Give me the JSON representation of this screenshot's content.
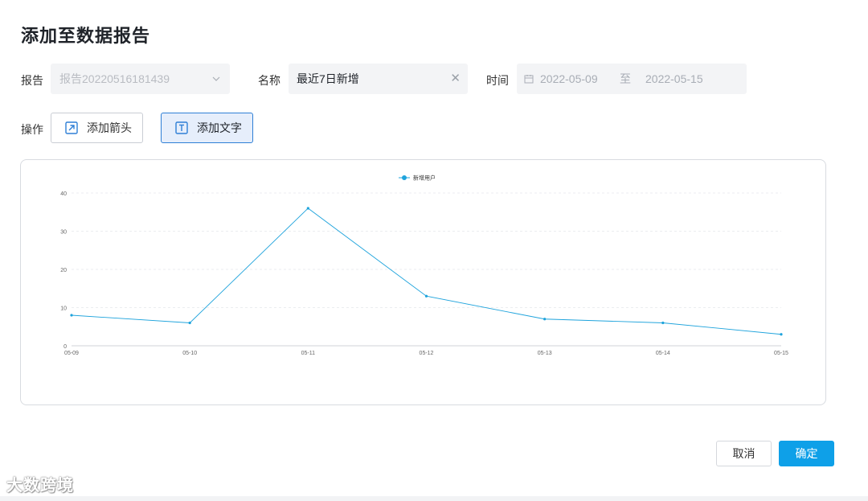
{
  "dialog": {
    "title": "添加至数据报告"
  },
  "form": {
    "report_label": "报告",
    "report_value": "报告20220516181439",
    "name_label": "名称",
    "name_value": "最近7日新增",
    "time_label": "时间",
    "date_start": "2022-05-09",
    "date_separator": "至",
    "date_end": "2022-05-15",
    "operation_label": "操作"
  },
  "operations": {
    "add_arrow": "添加箭头",
    "add_text": "添加文字"
  },
  "footer": {
    "cancel": "取消",
    "confirm": "确定"
  },
  "watermark": "大数跨境",
  "colors": {
    "accent": "#0ea0e8",
    "series": "#1ea3dc",
    "selected_bg": "#e6eefb",
    "selected_border": "#2e7fd6"
  },
  "icons": {
    "clear": "close-icon",
    "calendar": "calendar-icon",
    "dropdown": "chevron-down-icon",
    "arrow": "arrow-up-right-icon",
    "text": "text-icon"
  },
  "chart_data": {
    "type": "line",
    "x": [
      "05-09",
      "05-10",
      "05-11",
      "05-12",
      "05-13",
      "05-14",
      "05-15"
    ],
    "series": [
      {
        "name": "新增用户",
        "values": [
          8,
          6,
          36,
          13,
          7,
          6,
          3
        ]
      }
    ],
    "y_ticks": [
      "0",
      "10",
      "20",
      "30",
      "40"
    ],
    "ylim": [
      0,
      40
    ],
    "legend_position": "top-center",
    "grid": true
  }
}
